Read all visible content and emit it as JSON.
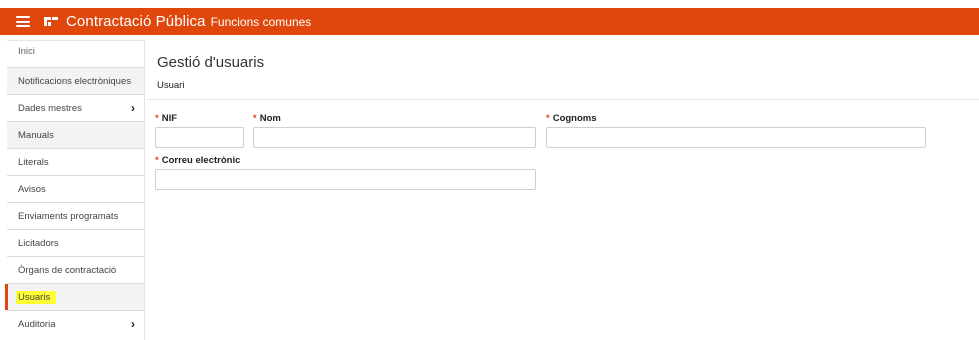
{
  "header": {
    "app_title": "Contractació Pública",
    "app_subtitle": "Funcions comunes",
    "brand_color": "#e0470c"
  },
  "sidebar": {
    "items": [
      {
        "label": "Inici"
      },
      {
        "label": "Notificacions electròniques"
      },
      {
        "label": "Dades mestres",
        "has_submenu": true
      },
      {
        "label": "Manuals"
      },
      {
        "label": "Literals"
      },
      {
        "label": "Avisos"
      },
      {
        "label": "Enviaments programats"
      },
      {
        "label": "Licitadors"
      },
      {
        "label": "Òrgans de contractació"
      },
      {
        "label": "Usuaris",
        "active": true,
        "highlight_color": "#ffff33"
      },
      {
        "label": "Auditoria",
        "has_submenu": true
      }
    ],
    "chevron_glyph": "›"
  },
  "main": {
    "page_title": "Gestió d'usuaris",
    "section_title": "Usuari",
    "required_marker": "*",
    "fields": {
      "nif": {
        "label": "NIF",
        "value": ""
      },
      "nom": {
        "label": "Nom",
        "value": ""
      },
      "cognoms": {
        "label": "Cognoms",
        "value": ""
      },
      "correu": {
        "label": "Correu electrònic",
        "value": ""
      }
    }
  }
}
